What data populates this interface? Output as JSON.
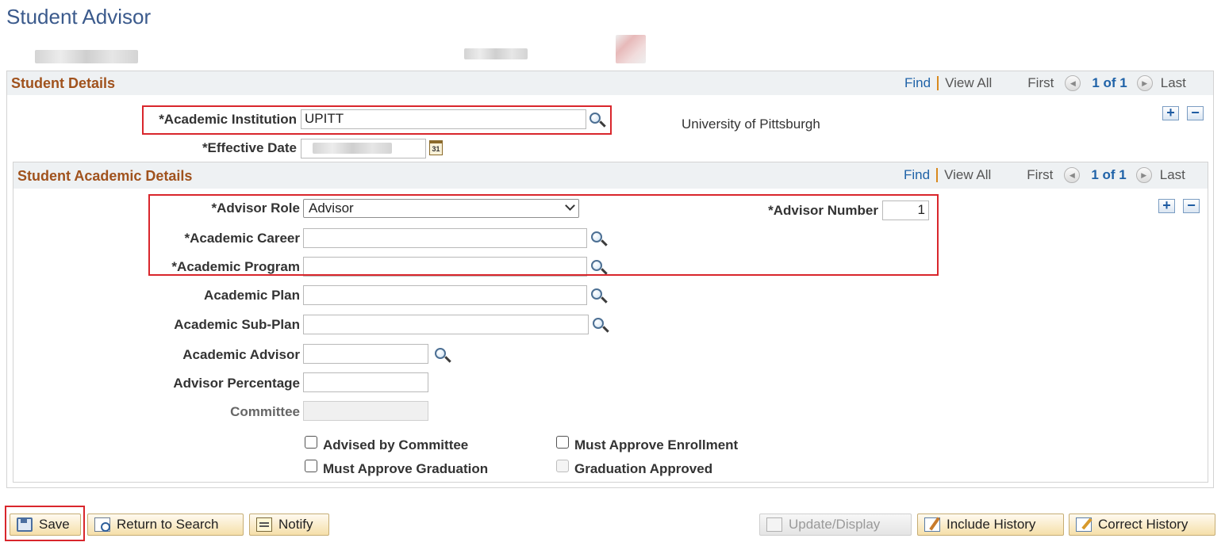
{
  "page": {
    "title": "Student Advisor"
  },
  "student_details": {
    "title": "Student Details",
    "nav": {
      "find": "Find",
      "view_all": "View All",
      "first": "First",
      "count": "1 of 1",
      "last": "Last"
    },
    "add_row": "+",
    "delete_row": "−",
    "academic_institution": {
      "label": "*Academic Institution",
      "value": "UPITT",
      "description": "University of Pittsburgh"
    },
    "effective_date": {
      "label": "*Effective Date",
      "calendar_day": "31"
    }
  },
  "academic_details": {
    "title": "Student Academic Details",
    "nav": {
      "find": "Find",
      "view_all": "View All",
      "first": "First",
      "count": "1 of 1",
      "last": "Last"
    },
    "add_row": "+",
    "delete_row": "−",
    "advisor_role": {
      "label": "*Advisor Role",
      "value": "Advisor"
    },
    "advisor_number": {
      "label": "*Advisor Number",
      "value": "1"
    },
    "academic_career": {
      "label": "*Academic Career",
      "value": ""
    },
    "academic_program": {
      "label": "*Academic Program",
      "value": ""
    },
    "academic_plan": {
      "label": "Academic Plan",
      "value": ""
    },
    "academic_sub_plan": {
      "label": "Academic Sub-Plan",
      "value": ""
    },
    "academic_advisor": {
      "label": "Academic Advisor",
      "value": ""
    },
    "advisor_percentage": {
      "label": "Advisor Percentage",
      "value": ""
    },
    "committee": {
      "label": "Committee",
      "value": ""
    },
    "checkboxes": {
      "advised_by_committee": "Advised by Committee",
      "must_approve_enrollment": "Must Approve Enrollment",
      "must_approve_graduation": "Must Approve Graduation",
      "graduation_approved": "Graduation Approved"
    }
  },
  "toolbar": {
    "save": "Save",
    "return_to_search": "Return to Search",
    "notify": "Notify",
    "update_display": "Update/Display",
    "include_history": "Include History",
    "correct_history": "Correct History"
  }
}
